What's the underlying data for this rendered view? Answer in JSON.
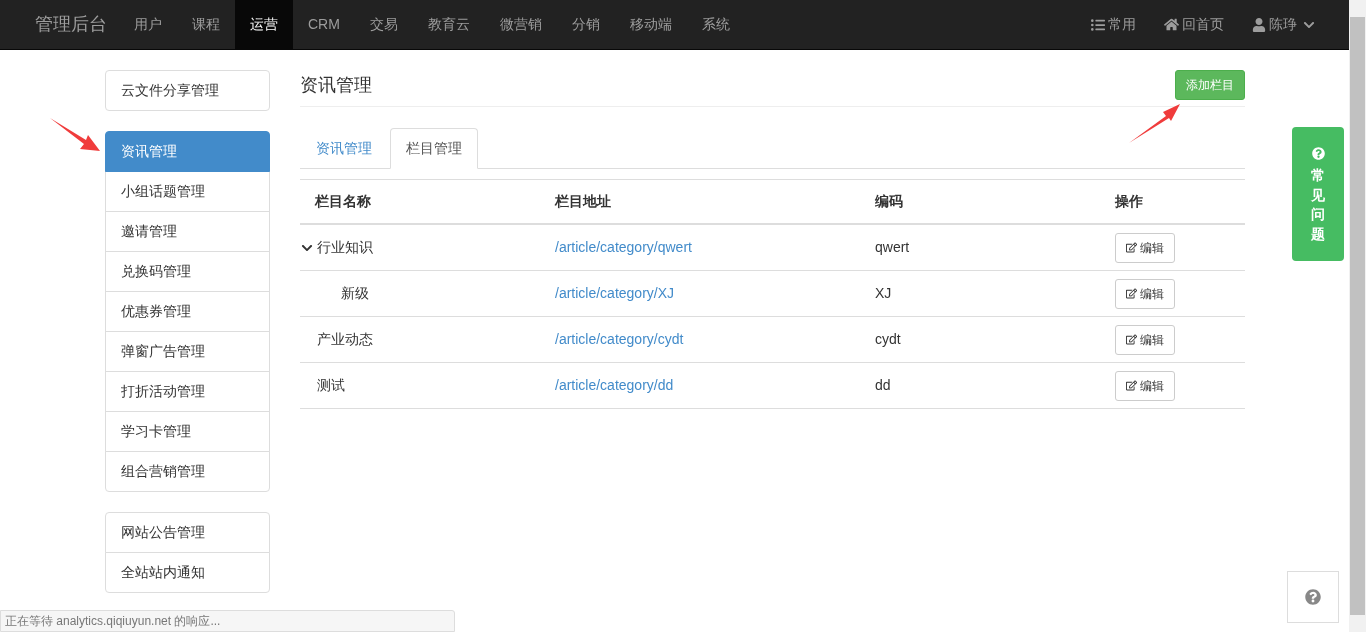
{
  "navbar": {
    "brand": "管理后台",
    "items": [
      {
        "label": "用户",
        "selected": false
      },
      {
        "label": "课程",
        "selected": false
      },
      {
        "label": "运营",
        "selected": true
      },
      {
        "label": "CRM",
        "selected": false
      },
      {
        "label": "交易",
        "selected": false
      },
      {
        "label": "教育云",
        "selected": false
      },
      {
        "label": "微营销",
        "selected": false
      },
      {
        "label": "分销",
        "selected": false
      },
      {
        "label": "移动端",
        "selected": false
      },
      {
        "label": "系统",
        "selected": false
      }
    ],
    "right": [
      {
        "kind": "list",
        "label": "常用"
      },
      {
        "kind": "home",
        "label": "回首页"
      },
      {
        "kind": "user",
        "label": "陈琤"
      }
    ]
  },
  "sidebar": {
    "groups": [
      [
        {
          "label": "云文件分享管理",
          "selected": false
        }
      ],
      [
        {
          "label": "资讯管理",
          "selected": true
        },
        {
          "label": "小组话题管理",
          "selected": false
        },
        {
          "label": "邀请管理",
          "selected": false
        },
        {
          "label": "兑换码管理",
          "selected": false
        },
        {
          "label": "优惠券管理",
          "selected": false
        },
        {
          "label": "弹窗广告管理",
          "selected": false
        },
        {
          "label": "打折活动管理",
          "selected": false
        },
        {
          "label": "学习卡管理",
          "selected": false
        },
        {
          "label": "组合营销管理",
          "selected": false
        }
      ],
      [
        {
          "label": "网站公告管理",
          "selected": false
        },
        {
          "label": "全站站内通知",
          "selected": false
        }
      ]
    ]
  },
  "page": {
    "title": "资讯管理",
    "add_button": "添加栏目",
    "tabs": [
      {
        "label": "资讯管理",
        "selected": false
      },
      {
        "label": "栏目管理",
        "selected": true
      }
    ],
    "table": {
      "columns": [
        "栏目名称",
        "栏目地址",
        "编码",
        "操作"
      ],
      "rows": [
        {
          "name": "行业知识",
          "path": "/article/category/qwert",
          "code": "qwert",
          "action": "编辑",
          "expanded": true,
          "children": [
            {
              "name": "新级",
              "path": "/article/category/XJ",
              "code": "XJ",
              "action": "编辑"
            }
          ]
        },
        {
          "name": "产业动态",
          "path": "/article/category/cydt",
          "code": "cydt",
          "action": "编辑"
        },
        {
          "name": "测试",
          "path": "/article/category/dd",
          "code": "dd",
          "action": "编辑"
        }
      ]
    }
  },
  "faq_tab": {
    "label": "常见问题"
  },
  "status_bar": "正在等待 analytics.qiqiuyun.net 的响应..."
}
